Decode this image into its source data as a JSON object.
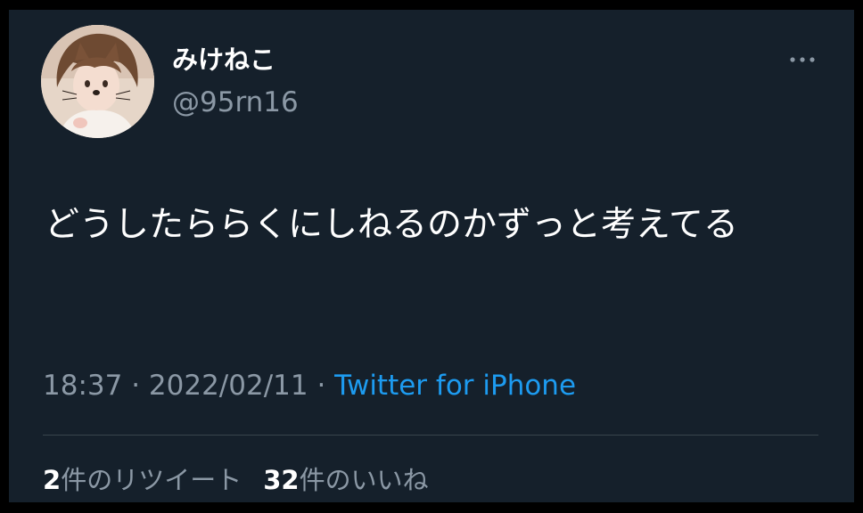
{
  "user": {
    "display_name": "みけねこ",
    "handle": "@95rn16",
    "avatar_icon": "profile-photo"
  },
  "menu": {
    "icon": "more-horizontal-icon"
  },
  "tweet": {
    "text": "どうしたららくにしねるのかずっと考えてる"
  },
  "meta": {
    "time": "18:37",
    "sep1": " · ",
    "date": "2022/02/11",
    "sep2": " · ",
    "source": "Twitter for iPhone"
  },
  "stats": {
    "retweets_count": "2",
    "retweets_label": "件のリツイート",
    "likes_count": "32",
    "likes_label": "件のいいね"
  },
  "colors": {
    "background": "#15202b",
    "text": "#ffffff",
    "secondary_text": "#8b98a5",
    "link": "#1d9bf0",
    "divider": "#38444d"
  }
}
